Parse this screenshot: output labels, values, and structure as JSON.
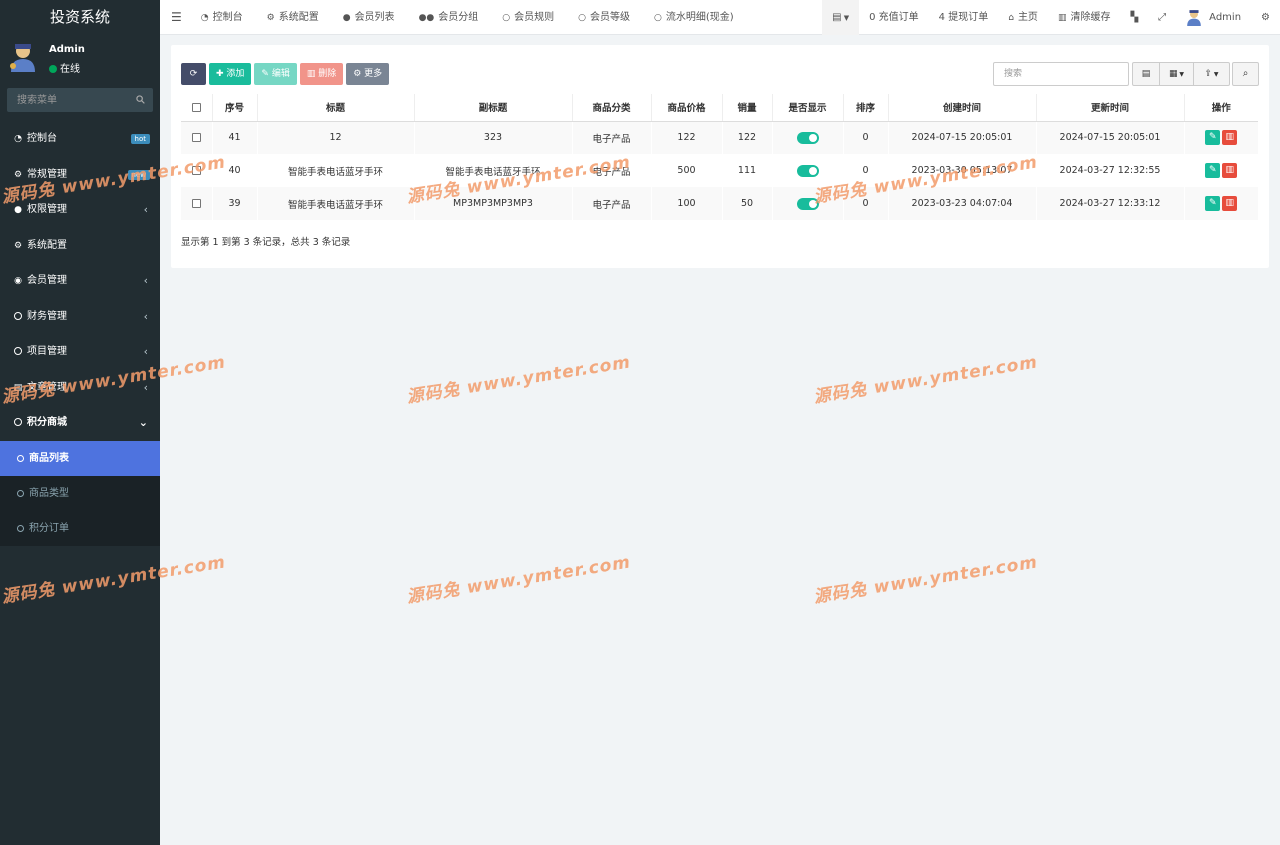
{
  "sidebar": {
    "brand": "投资系统",
    "user": {
      "name": "Admin",
      "status": "在线"
    },
    "search_placeholder": "搜索菜单",
    "menu": [
      {
        "label": "控制台",
        "icon": "dashboard-icon",
        "badge": "hot"
      },
      {
        "label": "常规管理",
        "icon": "cogs-icon",
        "badge": "new"
      },
      {
        "label": "权限管理",
        "icon": "group-icon",
        "chevron": "‹"
      },
      {
        "label": "系统配置",
        "icon": "gear-icon"
      },
      {
        "label": "会员管理",
        "icon": "user-circle-icon",
        "chevron": "‹"
      },
      {
        "label": "财务管理",
        "icon": "circle-icon",
        "chevron": "‹"
      },
      {
        "label": "项目管理",
        "icon": "circle-icon",
        "chevron": "‹"
      },
      {
        "label": "文章管理",
        "icon": "list-icon",
        "chevron": "‹"
      },
      {
        "label": "积分商城",
        "icon": "circle-icon",
        "chevron": "⌄"
      }
    ],
    "submenu": [
      {
        "label": "商品列表",
        "active": true
      },
      {
        "label": "商品类型"
      },
      {
        "label": "积分订单"
      }
    ]
  },
  "topnav": {
    "left": [
      {
        "label": "控制台",
        "icon": "dashboard-icon"
      },
      {
        "label": "系统配置",
        "icon": "gear-icon"
      },
      {
        "label": "会员列表",
        "icon": "user-icon"
      },
      {
        "label": "会员分组",
        "icon": "users-icon"
      },
      {
        "label": "会员规则",
        "icon": "circle-icon"
      },
      {
        "label": "会员等级",
        "icon": "circle-icon"
      },
      {
        "label": "流水明细(现金)",
        "icon": "circle-icon"
      }
    ],
    "right": [
      {
        "label": "0 充值订单"
      },
      {
        "label": "4 提现订单"
      },
      {
        "label": "主页",
        "icon": "home-icon"
      },
      {
        "label": "清除缓存",
        "icon": "trash-icon"
      }
    ],
    "admin_name": "Admin"
  },
  "toolbar": {
    "add": "添加",
    "edit": "编辑",
    "delete": "删除",
    "more": "更多",
    "search_placeholder": "搜索"
  },
  "table": {
    "headers": [
      "序号",
      "标题",
      "副标题",
      "商品分类",
      "商品价格",
      "销量",
      "是否显示",
      "排序",
      "创建时间",
      "更新时间",
      "操作"
    ],
    "rows": [
      {
        "id": "41",
        "title": "12",
        "subtitle": "323",
        "category": "电子产品",
        "price": "122",
        "sales": "122",
        "show": true,
        "sort": "0",
        "created": "2024-07-15 20:05:01",
        "updated": "2024-07-15 20:05:01"
      },
      {
        "id": "40",
        "title": "智能手表电话蓝牙手环",
        "subtitle": "智能手表电话蓝牙手环",
        "category": "电子产品",
        "price": "500",
        "sales": "111",
        "show": true,
        "sort": "0",
        "created": "2023-03-30 05:13:07",
        "updated": "2024-03-27 12:32:55"
      },
      {
        "id": "39",
        "title": "智能手表电话蓝牙手环",
        "subtitle": "MP3MP3MP3MP3",
        "category": "电子产品",
        "price": "100",
        "sales": "50",
        "show": true,
        "sort": "0",
        "created": "2023-03-23 04:07:04",
        "updated": "2024-03-27 12:33:12"
      }
    ]
  },
  "pager_text": "显示第 1 到第 3 条记录，总共 3 条记录",
  "watermark": "源码兔 www.ymter.com",
  "colors": {
    "sidebar": "#222d32",
    "active": "#4e73df",
    "green": "#18bc9c",
    "red": "#e74c3c"
  }
}
